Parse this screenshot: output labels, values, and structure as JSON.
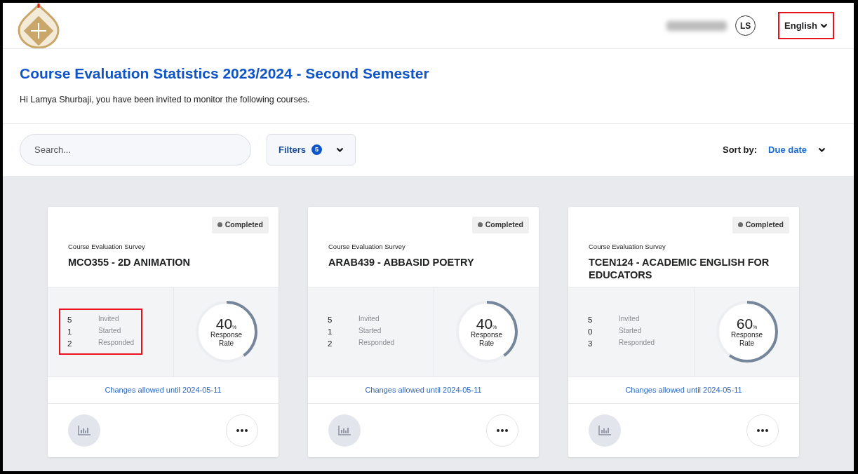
{
  "header": {
    "user_initials": "LS",
    "language": {
      "label": "English",
      "highlighted": true
    }
  },
  "page": {
    "title": "Course Evaluation Statistics 2023/2024 - Second Semester",
    "greeting": "Hi Lamya Shurbaji, you have been invited to monitor the following courses."
  },
  "toolbar": {
    "search": {
      "placeholder": "Search..."
    },
    "filters": {
      "label": "Filters",
      "count": "5"
    },
    "sort": {
      "label": "Sort by:",
      "value": "Due date"
    }
  },
  "cards": [
    {
      "status": "Completed",
      "survey": "Course Evaluation Survey",
      "title": "MCO355 - 2D ANIMATION",
      "stats": [
        {
          "value": "5",
          "label": "Invited"
        },
        {
          "value": "1",
          "label": "Started"
        },
        {
          "value": "2",
          "label": "Responded"
        }
      ],
      "stats_highlighted": true,
      "rate": "40",
      "rate_unit": "%",
      "rate_label": "Response Rate",
      "level": 0.4,
      "changes": "Changes allowed until 2024-05-11"
    },
    {
      "status": "Completed",
      "survey": "Course Evaluation Survey",
      "title": "ARAB439 - ABBASID POETRY",
      "stats": [
        {
          "value": "5",
          "label": "Invited"
        },
        {
          "value": "1",
          "label": "Started"
        },
        {
          "value": "2",
          "label": "Responded"
        }
      ],
      "stats_highlighted": false,
      "rate": "40",
      "rate_unit": "%",
      "rate_label": "Response Rate",
      "level": 0.4,
      "changes": "Changes allowed until 2024-05-11"
    },
    {
      "status": "Completed",
      "survey": "Course Evaluation Survey",
      "title": "TCEN124 - ACADEMIC ENGLISH FOR EDUCATORS",
      "stats": [
        {
          "value": "5",
          "label": "Invited"
        },
        {
          "value": "0",
          "label": "Started"
        },
        {
          "value": "3",
          "label": "Responded"
        }
      ],
      "stats_highlighted": false,
      "rate": "60",
      "rate_unit": "%",
      "rate_label": "Response Rate",
      "level": 0.6,
      "changes": "Changes allowed until 2024-05-11"
    }
  ]
}
